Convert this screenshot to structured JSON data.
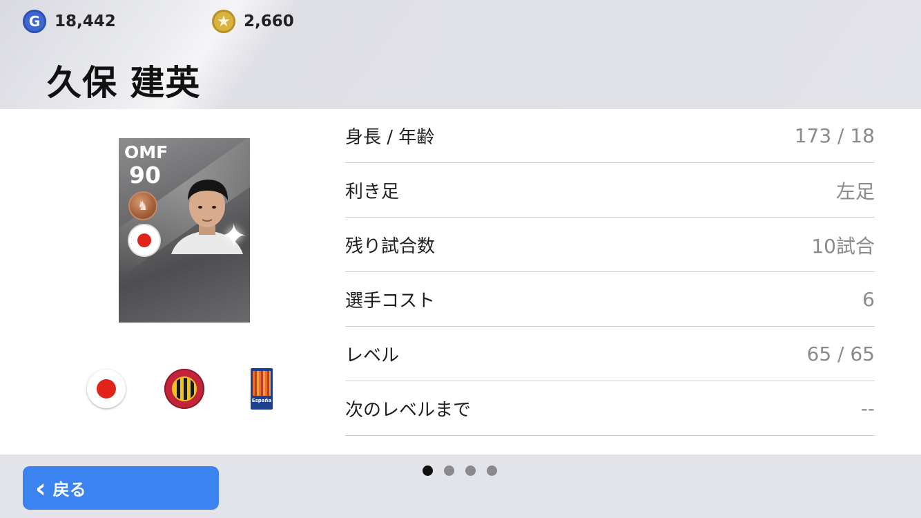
{
  "header": {
    "gp": {
      "icon": "gp-coin-icon",
      "value": "18,442"
    },
    "coins": {
      "icon": "star-coin-icon",
      "value": "2,660"
    },
    "player_name": "久保 建英"
  },
  "card": {
    "position": "OMF",
    "rating": "90",
    "medal_icon": "bronze-medal-icon",
    "flag_icon": "japan-flag-icon"
  },
  "badges": {
    "nationality": "japan-flag-icon",
    "club": "club-crest-icon",
    "league": {
      "icon": "league-badge-icon",
      "text": "España"
    }
  },
  "info_rows": [
    {
      "label": "身長 / 年齢",
      "value": "173 / 18"
    },
    {
      "label": "利き足",
      "value": "左足"
    },
    {
      "label": "残り試合数",
      "value": "10試合"
    },
    {
      "label": "選手コスト",
      "value": "6"
    },
    {
      "label": "レベル",
      "value": "65 / 65"
    },
    {
      "label": "次のレベルまで",
      "value": "--"
    }
  ],
  "footer": {
    "back_label": "戻る",
    "page_count": 4,
    "active_page": 1
  },
  "colors": {
    "accent": "#3b83f0",
    "gp_coin": "#3e67d1",
    "gold_coin": "#d8b340",
    "japan_red": "#e0241b"
  }
}
